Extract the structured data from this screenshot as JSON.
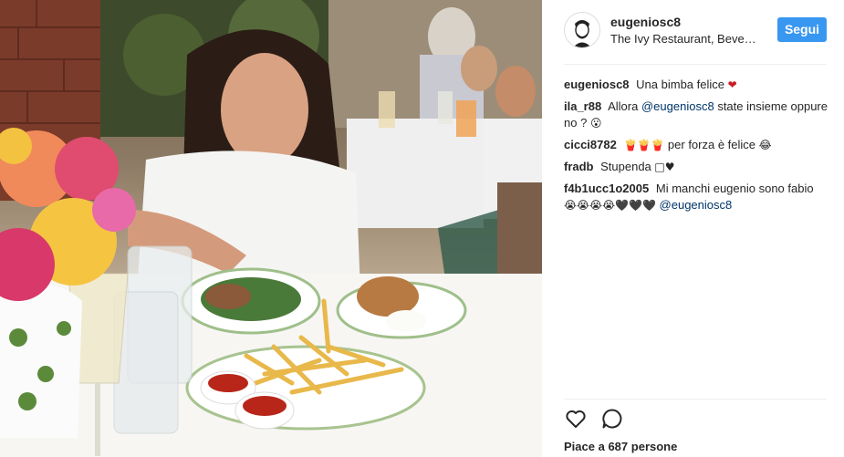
{
  "post": {
    "user": "eugeniosc8",
    "location": "The Ivy Restaurant, Beve…",
    "follow_label": "Segui"
  },
  "comments": [
    {
      "author": "eugeniosc8",
      "text": "Una bimba felice",
      "emoji": "❤"
    },
    {
      "author": "ila_r88",
      "text_before": "Allora",
      "mention": "@eugeniosc8",
      "text_after": "state insieme oppure no ?",
      "emoji": "😮"
    },
    {
      "author": "cicci8782",
      "emoji": "🍟🍟🍟",
      "text": "per forza è felice",
      "emoji_end": "😂"
    },
    {
      "author": "fradb",
      "text": "Stupenda",
      "emoji": "□♥"
    },
    {
      "author": "f4b1ucc1o2005",
      "text": "Mi manchi eugenio sono fabio",
      "emoji": "😭😭😭😭🖤🖤🖤",
      "mention": "@eugeniosc8"
    }
  ],
  "likes": {
    "prefix": "Piace a",
    "count": "687",
    "suffix": "persone"
  },
  "icons": {
    "like": "heart-outline-icon",
    "comment": "comment-bubble-icon"
  },
  "colors": {
    "follow_button": "#3897f0",
    "mention": "#003569",
    "heart": "#c81d25"
  }
}
